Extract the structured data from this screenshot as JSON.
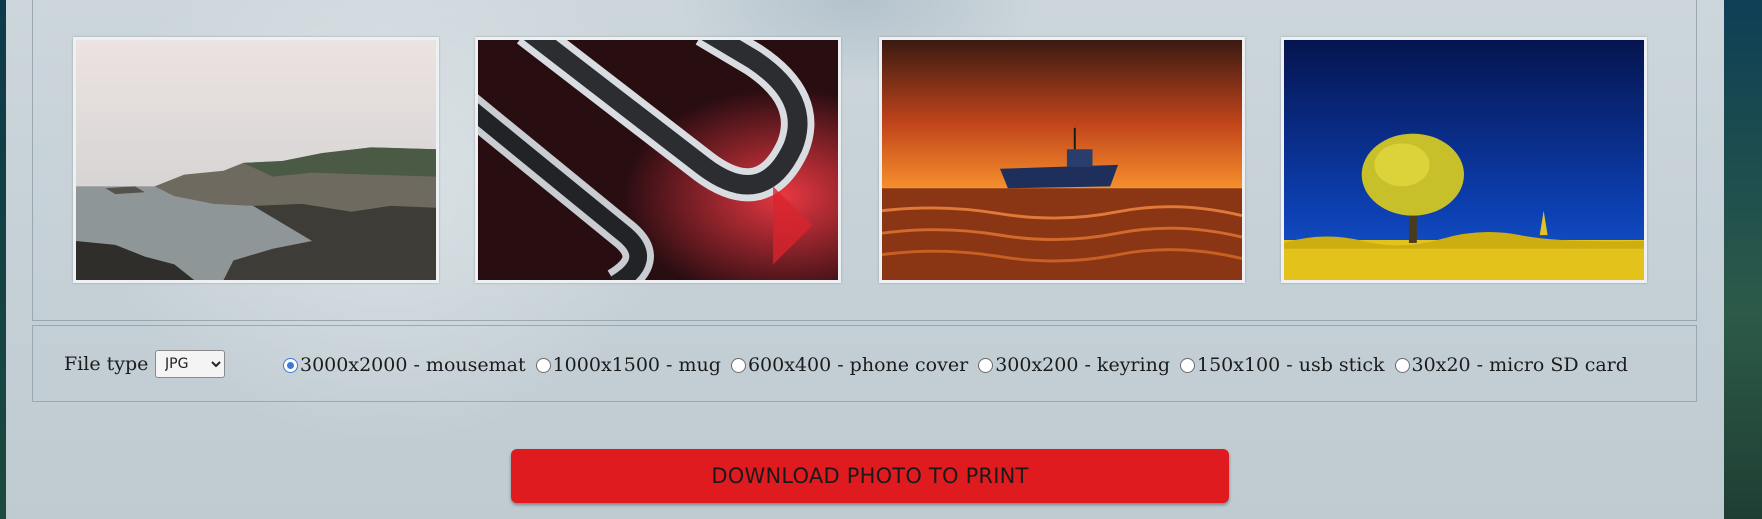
{
  "gallery": {
    "images": [
      {
        "subject": "misty coastal cliffs"
      },
      {
        "subject": "abstract chrome loops with red light"
      },
      {
        "subject": "boat on tidal flats at orange sunset"
      },
      {
        "subject": "yellow tree in golden field under blue sky"
      }
    ]
  },
  "options": {
    "file_type_label": "File type",
    "file_type_value": "JPG",
    "sizes": [
      {
        "label": "3000x2000 - mousemat",
        "selected": true
      },
      {
        "label": "1000x1500 - mug",
        "selected": false
      },
      {
        "label": "600x400 - phone cover",
        "selected": false
      },
      {
        "label": "300x200 - keyring",
        "selected": false
      },
      {
        "label": "150x100 - usb stick",
        "selected": false
      },
      {
        "label": "30x20 - micro SD card",
        "selected": false
      }
    ]
  },
  "download_button_label": "DOWNLOAD PHOTO TO PRINT",
  "colors": {
    "button": "#e01b1f",
    "radio_selected": "#3b7bd8",
    "panel": "#c8d3d9"
  }
}
